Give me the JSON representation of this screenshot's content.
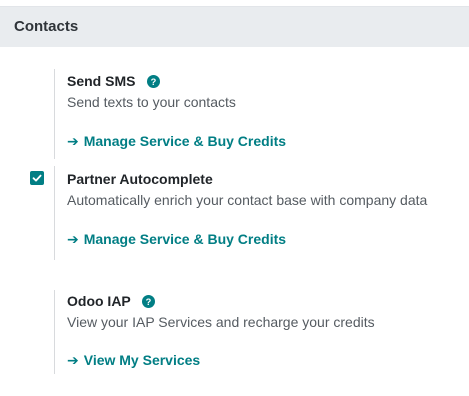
{
  "section": {
    "title": "Contacts"
  },
  "settings": [
    {
      "title": "Send SMS",
      "description": "Send texts to your contacts",
      "link_label": "Manage Service & Buy Credits",
      "has_help": true,
      "checkbox": null
    },
    {
      "title": "Partner Autocomplete",
      "description": "Automatically enrich your contact base with company data",
      "link_label": "Manage Service & Buy Credits",
      "has_help": false,
      "checkbox": "checked"
    },
    {
      "title": "Odoo IAP",
      "description": "View your IAP Services and recharge your credits",
      "link_label": "View My Services",
      "has_help": true,
      "checkbox": null
    }
  ],
  "icons": {
    "arrow": "arrow-right-icon",
    "help": "question-circle-icon",
    "check": "checkmark-icon"
  },
  "colors": {
    "accent": "#017e84",
    "header_bg": "#e9ecef"
  }
}
